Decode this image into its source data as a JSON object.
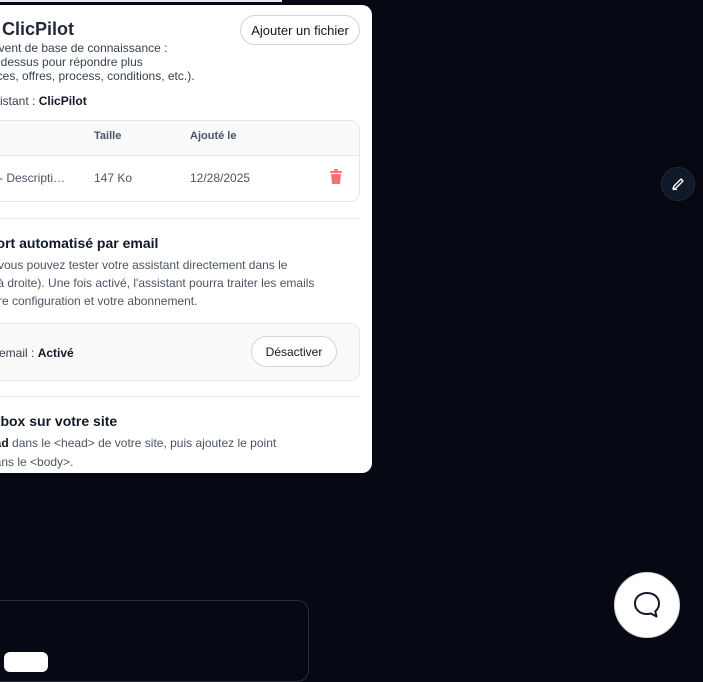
{
  "panel": {
    "title": "ClicPilot",
    "add_file_button": "Ajouter un fichier",
    "description_lines": [
      "ervent de base de connaissance :",
      "ie dessus pour répondre plus",
      "vices, offres, process, conditions, etc.)."
    ],
    "assistant_label": "ssistant : ",
    "assistant_name": "ClicPilot"
  },
  "files_table": {
    "headers": {
      "size": "Taille",
      "added": "Ajouté le"
    },
    "rows": [
      {
        "name": "b - Descripti…",
        "size": "147 Ko",
        "date": "12/28/2025"
      }
    ]
  },
  "email_section": {
    "title": "port automatisé par email",
    "lines": [
      "r, vous pouvez tester votre assistant directement dans le",
      "s à droite). Une fois activé, l'assistant pourra traiter les emails",
      "otre configuration et votre abonnement."
    ],
    "status_label": "email : ",
    "status_value": "Activé",
    "deactivate_button": "Désactiver"
  },
  "chatbox_section": {
    "title": "atbox sur votre site",
    "line1_bold": "ead",
    "line1_rest": " dans le <head> de votre site, puis ajoutez le point",
    "line2": "dans le <body>."
  },
  "icons": {
    "trash": "trash-icon",
    "edit": "pencil-icon",
    "chat": "chat-bubble-icon"
  },
  "colors": {
    "background": "#060913",
    "trash": "#f87171"
  }
}
